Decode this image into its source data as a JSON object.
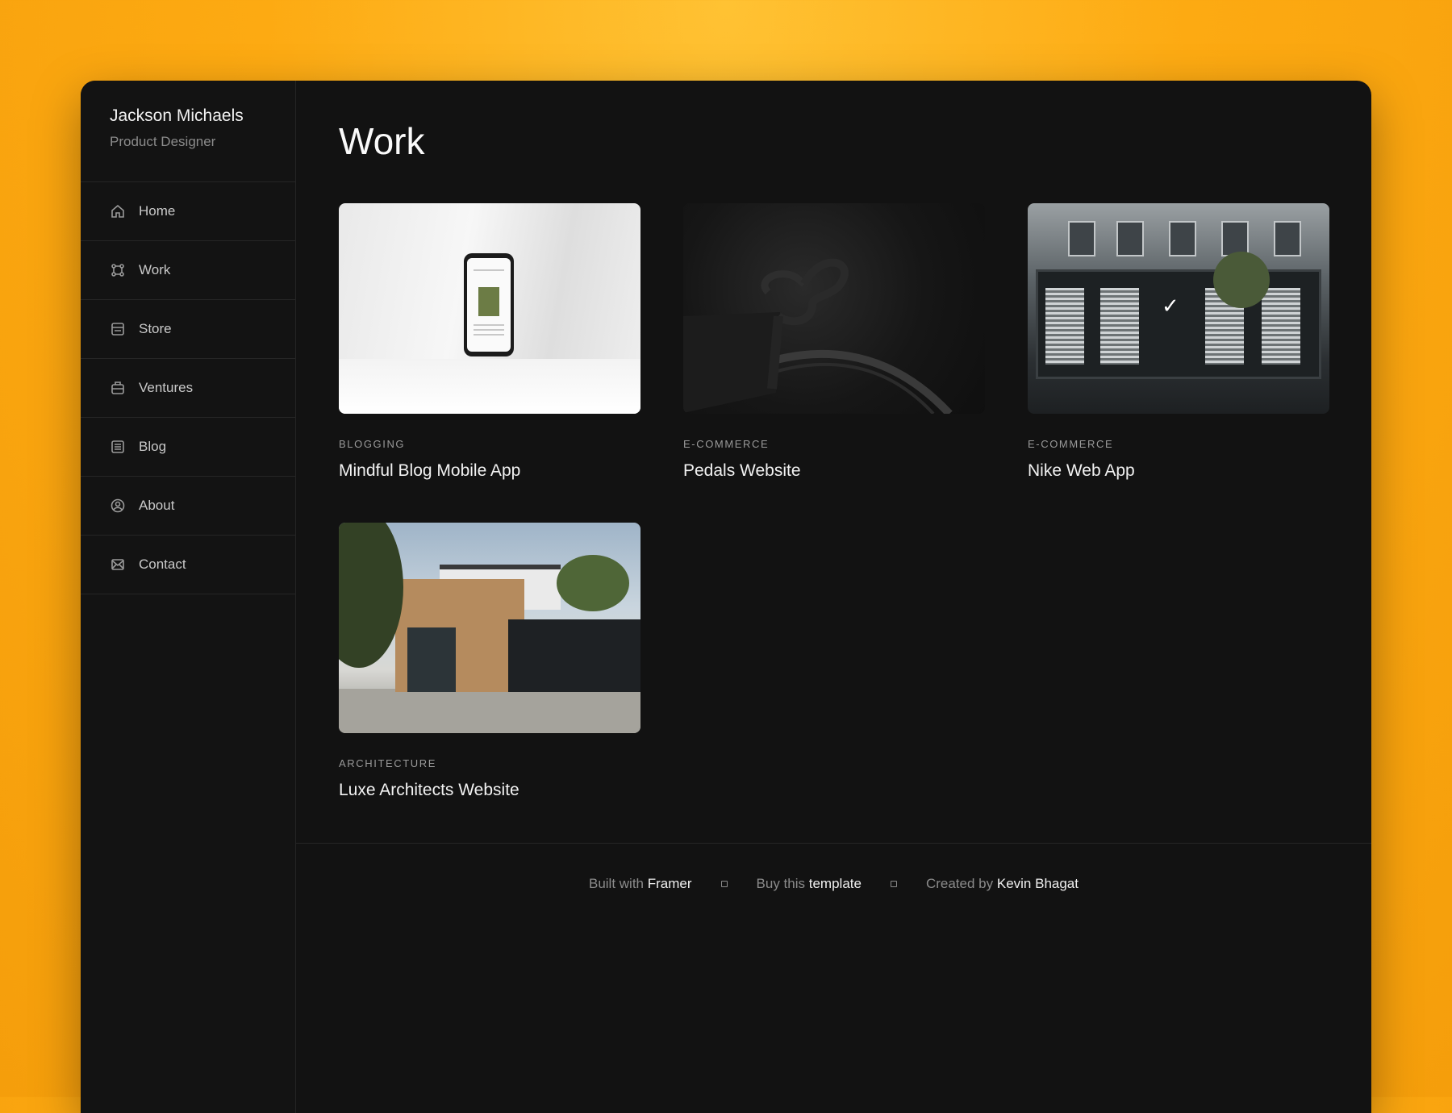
{
  "profile": {
    "name": "Jackson Michaels",
    "role": "Product Designer"
  },
  "nav": [
    {
      "label": "Home",
      "icon": "home-icon"
    },
    {
      "label": "Work",
      "icon": "work-icon"
    },
    {
      "label": "Store",
      "icon": "store-icon"
    },
    {
      "label": "Ventures",
      "icon": "briefcase-icon"
    },
    {
      "label": "Blog",
      "icon": "list-icon"
    },
    {
      "label": "About",
      "icon": "user-circle-icon"
    },
    {
      "label": "Contact",
      "icon": "mail-icon"
    }
  ],
  "page": {
    "title": "Work"
  },
  "projects": [
    {
      "category": "BLOGGING",
      "title": "Mindful Blog Mobile App"
    },
    {
      "category": "E-COMMERCE",
      "title": "Pedals Website"
    },
    {
      "category": "E-COMMERCE",
      "title": "Nike Web App"
    },
    {
      "category": "ARCHITECTURE",
      "title": "Luxe Architects Website"
    }
  ],
  "footer": {
    "built_prefix": "Built with",
    "built_link": "Framer",
    "buy_prefix": "Buy this",
    "buy_link": "template",
    "created_prefix": "Created by",
    "created_link": "Kevin Bhagat"
  },
  "colors": {
    "background": "#fdaa12",
    "window": "#121212",
    "text": "#f2f2f2",
    "muted": "#8b8b8b"
  }
}
